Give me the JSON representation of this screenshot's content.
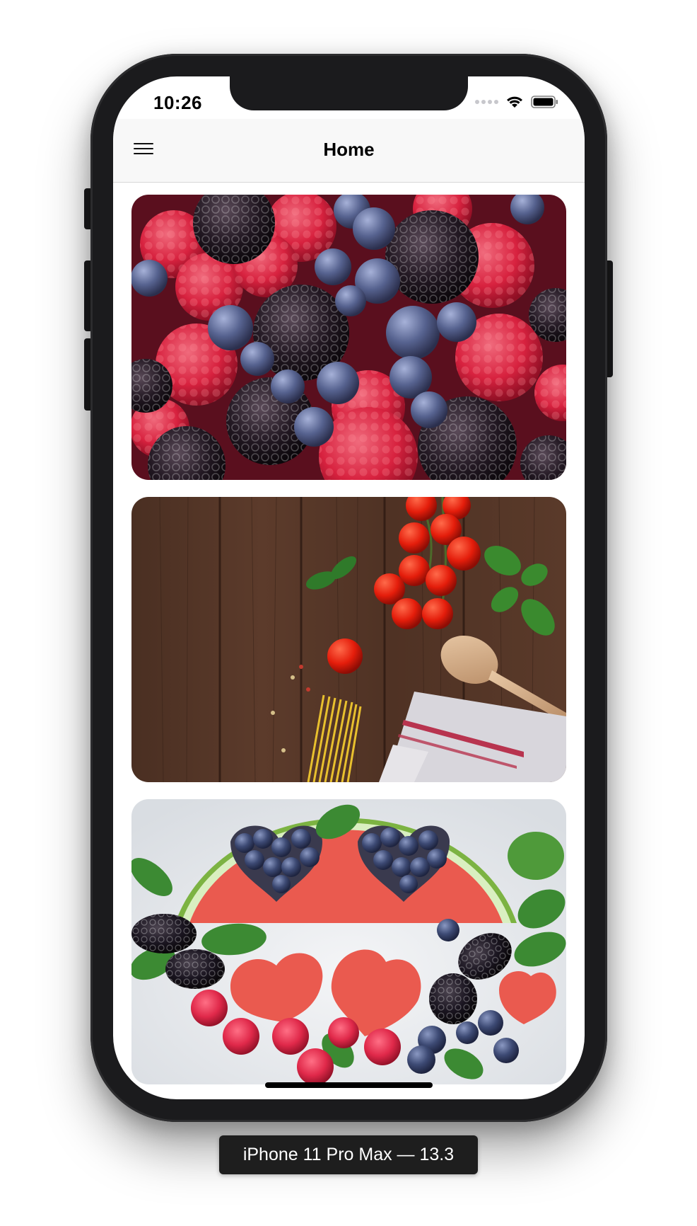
{
  "status_bar": {
    "time": "10:26",
    "icons": [
      "signal-icon",
      "wifi-icon",
      "battery-icon"
    ]
  },
  "navbar": {
    "title": "Home",
    "menu_icon": "hamburger-menu-icon"
  },
  "cards": [
    {
      "subject": "berries"
    },
    {
      "subject": "pasta-tomatoes"
    },
    {
      "subject": "watermelon-hearts"
    }
  ],
  "device_label": "iPhone 11 Pro Max — 13.3",
  "colors": {
    "frame": "#1b1b1d",
    "navbar_bg": "#f8f8f8",
    "caption_bg": "#1e1e1e"
  }
}
